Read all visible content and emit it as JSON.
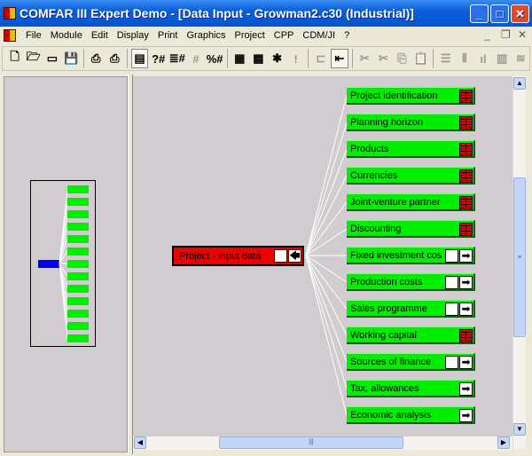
{
  "window": {
    "title": "COMFAR III Expert Demo - [Data Input - Growman2.c30 (Industrial)]",
    "minimize": "_",
    "maximize": "□",
    "close": "✕"
  },
  "menu": [
    "File",
    "Module",
    "Edit",
    "Display",
    "Print",
    "Graphics",
    "Project",
    "CPP",
    "CDM/JI",
    "?"
  ],
  "mdi": {
    "minimize": "_",
    "restore": "❐",
    "close": "✕"
  },
  "toolbar": [
    {
      "name": "new-icon",
      "g": "🗋",
      "dis": false
    },
    {
      "name": "open-icon",
      "g": "🗁",
      "dis": false
    },
    {
      "name": "folder-icon",
      "g": "▭",
      "dis": false
    },
    {
      "name": "save-icon",
      "g": "💾",
      "dis": true
    },
    "sep",
    {
      "name": "print-icon",
      "g": "⎙",
      "dis": false
    },
    {
      "name": "print-setup-icon",
      "g": "⎙",
      "dis": false
    },
    "sep",
    {
      "name": "input-form-icon",
      "g": "▤",
      "dis": false,
      "on": true
    },
    {
      "name": "query-number-icon",
      "g": "?#",
      "dis": false
    },
    {
      "name": "list-number-icon",
      "g": "≣#",
      "dis": false
    },
    {
      "name": "hash-icon",
      "g": "#",
      "dis": true
    },
    {
      "name": "percent-number-icon",
      "g": "%#",
      "dis": false
    },
    "sep",
    {
      "name": "grid-icon",
      "g": "▦",
      "dis": false
    },
    {
      "name": "calculator-icon",
      "g": "▩",
      "dis": false
    },
    {
      "name": "new-item-icon",
      "g": "✱",
      "dis": false
    },
    {
      "name": "exclamation-icon",
      "g": "!",
      "dis": true
    },
    "sep",
    {
      "name": "tree-expand-icon",
      "g": "⊏",
      "dis": true
    },
    {
      "name": "tree-input-icon",
      "g": "⇤",
      "dis": false,
      "on": true
    },
    "sep",
    {
      "name": "cut-icon",
      "g": "✂",
      "dis": true
    },
    {
      "name": "cut-percent-icon",
      "g": "✂",
      "dis": true
    },
    {
      "name": "copy-icon",
      "g": "⎘",
      "dis": true
    },
    {
      "name": "paste-icon",
      "g": "📋",
      "dis": true
    },
    "sep",
    {
      "name": "rows-icon",
      "g": "☰",
      "dis": true
    },
    {
      "name": "columns-icon",
      "g": "⦀",
      "dis": true
    },
    {
      "name": "bars-icon",
      "g": "ıl",
      "dis": true
    },
    {
      "name": "chart-icon",
      "g": "▥",
      "dis": true
    },
    {
      "name": "curves-icon",
      "g": "≋",
      "dis": true
    }
  ],
  "root": {
    "label": "Project - input data",
    "icon": "🡄"
  },
  "nodes": [
    {
      "label": "Project identification",
      "icon": "table"
    },
    {
      "label": "Planning horizon",
      "icon": "table"
    },
    {
      "label": "Products",
      "icon": "table"
    },
    {
      "label": "Currencies",
      "icon": "table"
    },
    {
      "label": "Joint-venture partner",
      "icon": "table"
    },
    {
      "label": "Discounting",
      "icon": "table"
    },
    {
      "label": "Fixed investment cos",
      "icon": "blank-arrow"
    },
    {
      "label": "Production costs",
      "icon": "blank-arrow"
    },
    {
      "label": "Sales programme",
      "icon": "blank-arrow"
    },
    {
      "label": "Working capital",
      "icon": "table"
    },
    {
      "label": "Sources of finance",
      "icon": "blank-arrow"
    },
    {
      "label": "Tax, allowances",
      "icon": "arrow"
    },
    {
      "label": "Economic analysis",
      "icon": "arrow"
    }
  ],
  "arrow_glyph": "➡",
  "colors": {
    "node": "#00ee00",
    "root": "#ee0000",
    "overview_root": "#0000ff"
  }
}
